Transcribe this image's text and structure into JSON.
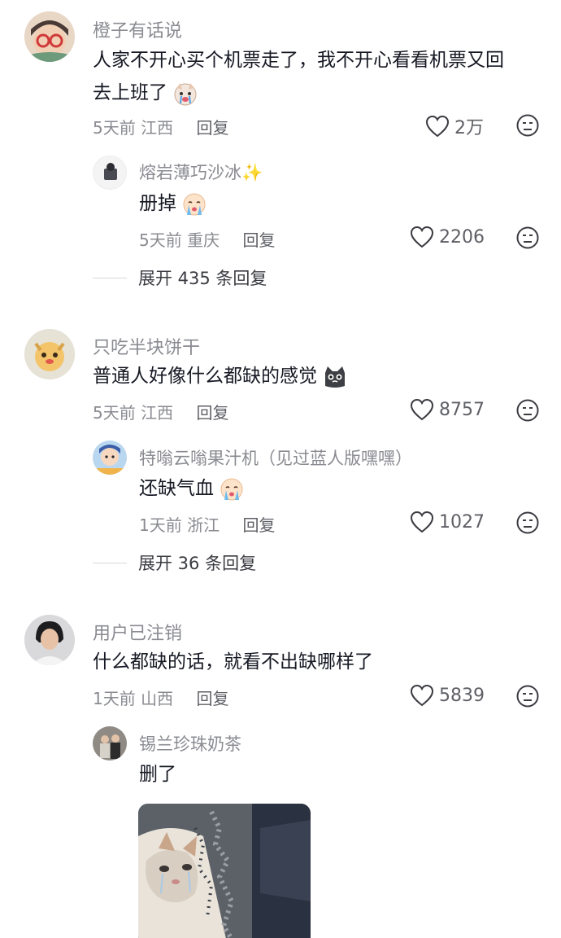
{
  "comments": [
    {
      "username": "橙子有话说",
      "text": "人家不开心买个机票走了，我不开心看看机票又回去上班了",
      "line1": "人家不开心买个机票走了，我不开心看看机票又回",
      "line2": "去上班了",
      "emoji": "crying-dog-emoji",
      "date": "5天前",
      "location": "江西",
      "reply_label": "回复",
      "likes": "2万",
      "reply": {
        "username": "熔岩薄巧沙冰✨",
        "text": "册掉",
        "emoji": "crying-emoji",
        "date": "5天前",
        "location": "重庆",
        "reply_label": "回复",
        "likes": "2206"
      },
      "expand_label": "展开 435 条回复"
    },
    {
      "username": "只吃半块饼干",
      "text": "普通人好像什么都缺的感觉",
      "emoji": "cat-emoji",
      "date": "5天前",
      "location": "江西",
      "reply_label": "回复",
      "likes": "8757",
      "reply": {
        "username": "特嗡云嗡果汁机（见过蓝人版嘿嘿）",
        "text": "还缺气血",
        "emoji": "crying-emoji",
        "date": "1天前",
        "location": "浙江",
        "reply_label": "回复",
        "likes": "1027"
      },
      "expand_label": "展开 36 条回复"
    },
    {
      "username": "用户已注销",
      "text": "什么都缺的话，就看不出缺哪样了",
      "date": "1天前",
      "location": "山西",
      "reply_label": "回复",
      "likes": "5839",
      "reply": {
        "username": "锡兰珍珠奶茶",
        "text": "删了",
        "image": "crying-cat-photo"
      }
    }
  ],
  "colors": {
    "text": "#161823",
    "secondary": "#8a8b91",
    "background": "#ffffff"
  },
  "icons": {
    "like": "heart-outline-icon",
    "dislike": "dislike-face-icon"
  }
}
